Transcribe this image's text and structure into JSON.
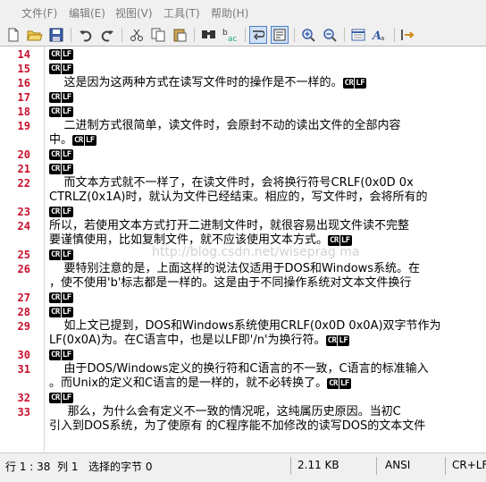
{
  "menu": [
    "文件(F)",
    "编辑(E)",
    "视图(V)",
    "工具(T)",
    "帮助(H)"
  ],
  "toolbar_icons": [
    "new-file-icon",
    "open-folder-icon",
    "save-icon",
    "undo-icon",
    "redo-icon",
    "cut-icon",
    "copy-icon",
    "paste-icon",
    "find-icon",
    "replace-icon",
    "word-wrap-icon",
    "show-symbols-icon",
    "zoom-in-icon",
    "zoom-out-icon",
    "settings-icon",
    "font-icon",
    "extra-icon"
  ],
  "eol": {
    "cr": "CR",
    "lf": "LF"
  },
  "lines": [
    {
      "n": "14",
      "text": ""
    },
    {
      "n": "15",
      "text": ""
    },
    {
      "n": "16",
      "text": "    这是因为这两种方式在读写文件时的操作是不一样的。"
    },
    {
      "n": "17",
      "text": ""
    },
    {
      "n": "18",
      "text": ""
    },
    {
      "n": "19",
      "text": "    二进制方式很简单，读文件时，会原封不动的读出文件的全部内容"
    },
    {
      "n": "",
      "text": "中。"
    },
    {
      "n": "20",
      "text": ""
    },
    {
      "n": "21",
      "text": ""
    },
    {
      "n": "22",
      "text": "    而文本方式就不一样了，在读文件时，会将换行符号CRLF(0x0D 0x"
    },
    {
      "n": "",
      "text": "CTRLZ(0x1A)时，就认为文件已经结束。相应的，写文件时，会将所有的"
    },
    {
      "n": "23",
      "text": ""
    },
    {
      "n": "24",
      "text": "所以，若使用文本方式打开二进制文件时，就很容易出现文件读不完整"
    },
    {
      "n": "",
      "text": "要谨慎使用，比如复制文件，就不应该使用文本方式。"
    },
    {
      "n": "25",
      "text": ""
    },
    {
      "n": "26",
      "text": "    要特别注意的是，上面这样的说法仅适用于DOS和Windows系统。在"
    },
    {
      "n": "",
      "text": "，使不使用'b'标志都是一样的。这是由于不同操作系统对文本文件换行"
    },
    {
      "n": "27",
      "text": ""
    },
    {
      "n": "28",
      "text": ""
    },
    {
      "n": "29",
      "text": "    如上文已提到，DOS和Windows系统使用CRLF(0x0D 0x0A)双字节作为"
    },
    {
      "n": "",
      "text": "LF(0x0A)为。在C语言中，也是以LF即'/n'为换行符。"
    },
    {
      "n": "30",
      "text": ""
    },
    {
      "n": "31",
      "text": "    由于DOS/Windows定义的换行符和C语言的不一致，C语言的标准输入"
    },
    {
      "n": "",
      "text": "。而Unix的定义和C语言的是一样的，就不必转换了。"
    },
    {
      "n": "32",
      "text": ""
    },
    {
      "n": "33",
      "text": "     那么，为什么会有定义不一致的情况呢，这纯属历史原因。当初C"
    },
    {
      "n": "",
      "text": "引入到DOS系统，为了使原有 的C程序能不加修改的读写DOS的文本文件"
    }
  ],
  "watermark": "http://blog.csdn.net/wiseprag ma",
  "status": {
    "position": "行 1 : 38",
    "column": "列 1",
    "selection": "选择的字节 0",
    "size": "2.11 KB",
    "encoding": "ANSI",
    "eol": "CR+LF"
  }
}
